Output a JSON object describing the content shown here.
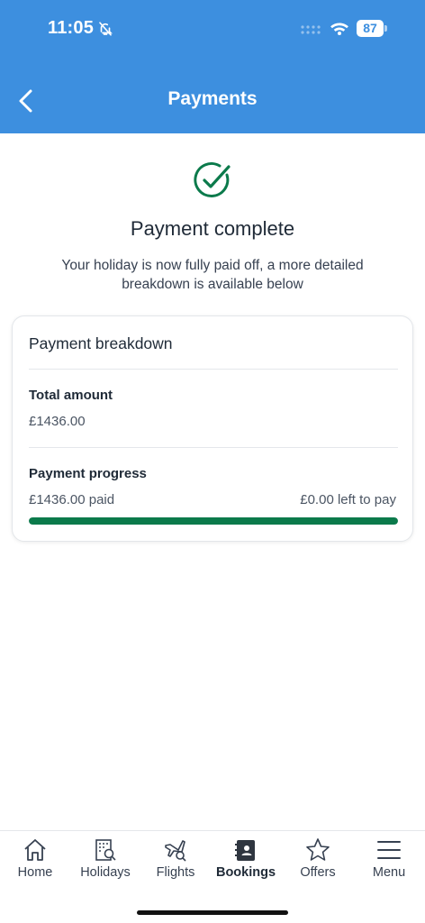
{
  "status_bar": {
    "time": "11:05",
    "battery": "87",
    "icons": [
      "bell-slash-icon",
      "signal-icon",
      "wifi-icon",
      "battery-icon"
    ]
  },
  "header": {
    "title": "Payments",
    "back_icon": "chevron-left-icon",
    "background_color": "#3d8fdf"
  },
  "success": {
    "icon": "check-circle-icon",
    "title": "Payment complete",
    "message": "Your holiday is now fully paid off, a more detailed breakdown is available below",
    "icon_color": "#0b7a4b"
  },
  "breakdown": {
    "title": "Payment breakdown",
    "total_label": "Total amount",
    "total_value": "£1436.00",
    "progress_label": "Payment progress",
    "paid_text": "£1436.00 paid",
    "left_text": "£0.00 left to pay",
    "progress_fraction": 1.0,
    "progress_color": "#0b7a4b"
  },
  "tabbar": {
    "tabs": [
      {
        "label": "Home",
        "icon": "home-icon",
        "active": false
      },
      {
        "label": "Holidays",
        "icon": "hotel-search-icon",
        "active": false
      },
      {
        "label": "Flights",
        "icon": "plane-search-icon",
        "active": false
      },
      {
        "label": "Bookings",
        "icon": "bookings-icon",
        "active": true
      },
      {
        "label": "Offers",
        "icon": "star-icon",
        "active": false
      },
      {
        "label": "Menu",
        "icon": "menu-icon",
        "active": false
      }
    ]
  }
}
